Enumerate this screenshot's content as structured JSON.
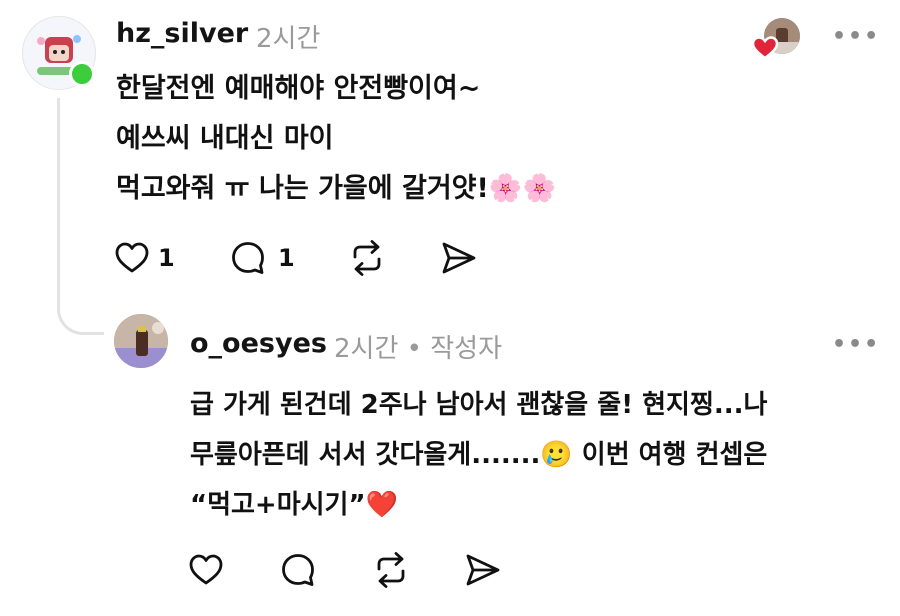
{
  "comment": {
    "username": "hz_silver",
    "time": "2시간",
    "lines": [
      "한달전엔 예매해야 안전빵이여~",
      "예쓰씨 내대신 마이",
      "먹고와줘 ㅠ 나는 가을에 갈거얏!🌸🌸"
    ],
    "like_count": "1",
    "reply_count": "1",
    "more_label": "•••"
  },
  "reply": {
    "username": "o_oesyes",
    "meta": "2시간 • 작성자",
    "lines": [
      "급 가게 된건데 2주나 남아서 괜찮을 줄! 현지찡...나",
      "무릎아픈데 서서 갓다올게.......🥲 이번 여행 컨셉은",
      "“먹고+마시기”❤️"
    ],
    "more_label": "•••"
  },
  "colors": {
    "online_dot": "#3ccc3c",
    "heart_badge": "#e0253a",
    "thread_line": "#e2e2e2"
  },
  "icons": [
    "heart-icon",
    "comment-icon",
    "repost-icon",
    "send-icon",
    "more-icon"
  ]
}
